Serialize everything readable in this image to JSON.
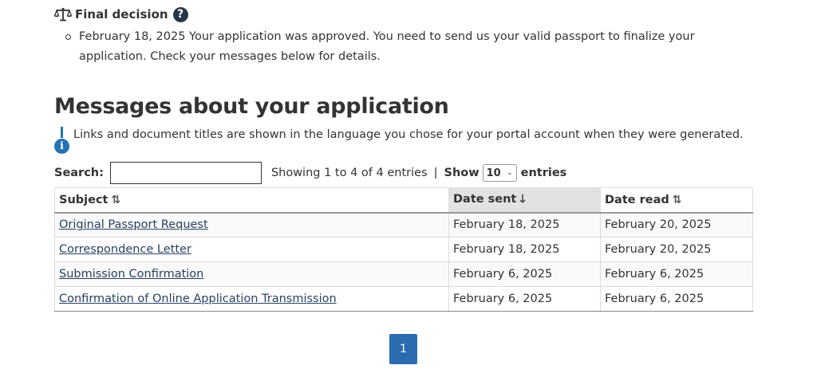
{
  "decision": {
    "title": "Final decision",
    "help_glyph": "?",
    "item": "February 18, 2025 Your application was approved. You need to send us your valid passport to finalize your application. Check your messages below for details."
  },
  "messages": {
    "heading": "Messages about your application",
    "info_text": "Links and document titles are shown in the language you chose for your portal account when they were generated.",
    "info_glyph": "i",
    "search_label": "Search:",
    "search_value": "",
    "count_text": "Showing 1 to 4 of 4 entries",
    "separator": "|",
    "show_label": "Show",
    "length_value": "10",
    "entries_label": "entries",
    "columns": {
      "subject": "Subject",
      "date_sent": "Date sent",
      "date_read": "Date read"
    },
    "sort_icons": {
      "subject": "⇅",
      "date_sent": "🡓",
      "date_read": "⇅"
    },
    "rows": [
      {
        "subject": "Original Passport Request",
        "sent": "February 18, 2025",
        "read": "February 20, 2025"
      },
      {
        "subject": "Correspondence Letter",
        "sent": "February 18, 2025",
        "read": "February 20, 2025"
      },
      {
        "subject": "Submission Confirmation",
        "sent": "February 6, 2025",
        "read": "February 6, 2025"
      },
      {
        "subject": "Confirmation of Online Application Transmission",
        "sent": "February 6, 2025",
        "read": "February 6, 2025"
      }
    ],
    "page_current": "1"
  },
  "colors": {
    "link": "#284162",
    "accent_blue": "#2572b4",
    "pagination_bg": "#2b6bb0",
    "help_icon_bg": "#26374a"
  }
}
